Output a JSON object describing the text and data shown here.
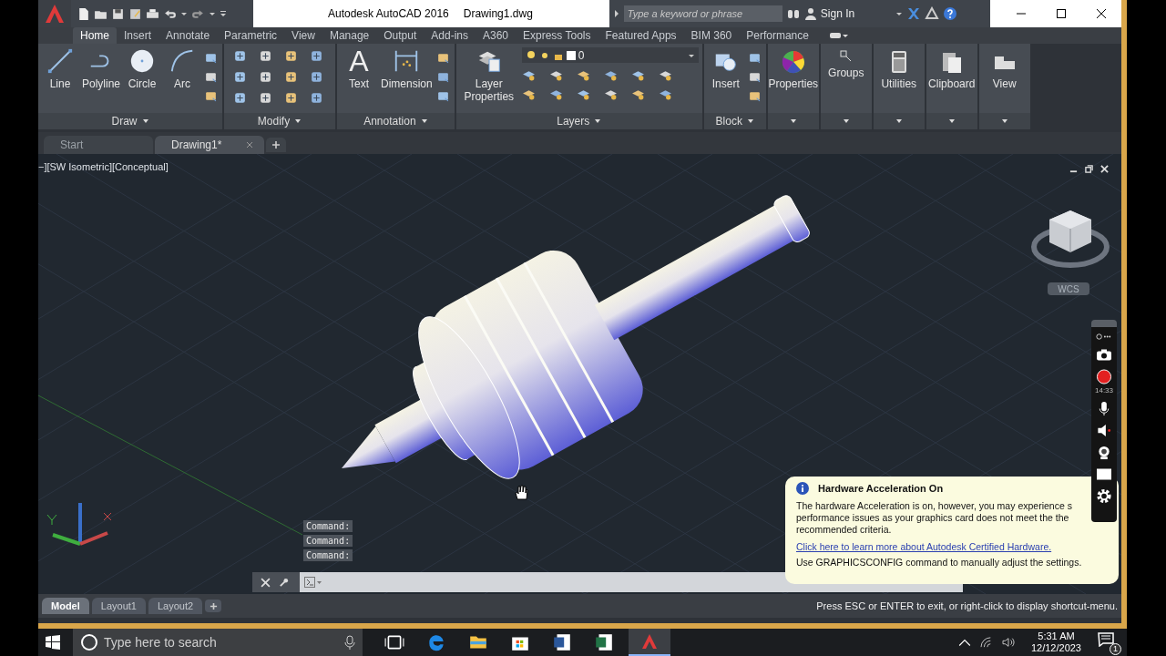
{
  "window": {
    "title": "Autodesk AutoCAD 2016",
    "document": "Drawing1.dwg"
  },
  "search": {
    "placeholder": "Type a keyword or phrase"
  },
  "account": {
    "label": "Sign In"
  },
  "ribbon_tabs": [
    {
      "label": "Home",
      "selected": true
    },
    {
      "label": "Insert",
      "selected": false
    },
    {
      "label": "Annotate",
      "selected": false
    },
    {
      "label": "Parametric",
      "selected": false
    },
    {
      "label": "View",
      "selected": false
    },
    {
      "label": "Manage",
      "selected": false
    },
    {
      "label": "Output",
      "selected": false
    },
    {
      "label": "Add-ins",
      "selected": false
    },
    {
      "label": "A360",
      "selected": false
    },
    {
      "label": "Express Tools",
      "selected": false
    },
    {
      "label": "Featured Apps",
      "selected": false
    },
    {
      "label": "BIM 360",
      "selected": false
    },
    {
      "label": "Performance",
      "selected": false
    }
  ],
  "panels": [
    {
      "kind": "tools",
      "title": "Draw",
      "tools": [
        {
          "label": "Line"
        },
        {
          "label": "Polyline"
        },
        {
          "label": "Circle"
        },
        {
          "label": "Arc"
        }
      ]
    },
    {
      "kind": "icons",
      "title": "Modify"
    },
    {
      "kind": "tools",
      "title": "Annotation",
      "tools": [
        {
          "label": "Text",
          "glyph": "A"
        },
        {
          "label": "Dimension"
        }
      ]
    },
    {
      "kind": "layers",
      "title": "Layers",
      "tools": [
        {
          "label": "Layer Properties"
        }
      ],
      "layer": "0"
    },
    {
      "kind": "tools",
      "title": "Block",
      "tools": [
        {
          "label": "Insert"
        }
      ]
    },
    {
      "kind": "collapsed",
      "title": "Properties"
    },
    {
      "kind": "collapsed",
      "title": "Groups"
    },
    {
      "kind": "collapsed",
      "title": "Utilities"
    },
    {
      "kind": "collapsed",
      "title": "Clipboard"
    },
    {
      "kind": "collapsed",
      "title": "View"
    }
  ],
  "file_tabs": [
    {
      "label": "Start",
      "selected": false
    },
    {
      "label": "Drawing1*",
      "selected": true
    }
  ],
  "viewport": {
    "controls": "−][SW Isometric][Conceptual]",
    "coordinate_system": "WCS",
    "command_history": [
      "Command:",
      "Command:",
      "Command:"
    ]
  },
  "recorder": {
    "elapsed": "14:33"
  },
  "notification": {
    "title": "Hardware Acceleration On",
    "body": "The hardware Acceleration is on, however, you may experience s performance issues as your graphics card does not meet the the recommended criteria.",
    "link": "Click here to learn more about  Autodesk Certified Hardware.",
    "hint": "Use GRAPHICSCONFIG command to manually adjust the settings."
  },
  "layout_tabs": [
    {
      "label": "Model",
      "selected": true
    },
    {
      "label": "Layout1",
      "selected": false
    },
    {
      "label": "Layout2",
      "selected": false
    }
  ],
  "status": "Press ESC or ENTER to exit, or right-click to display shortcut-menu.",
  "taskbar": {
    "search": {
      "placeholder": "Type here to search"
    },
    "time": "5:31 AM",
    "date": "12/12/2023",
    "notification_count": "1"
  }
}
